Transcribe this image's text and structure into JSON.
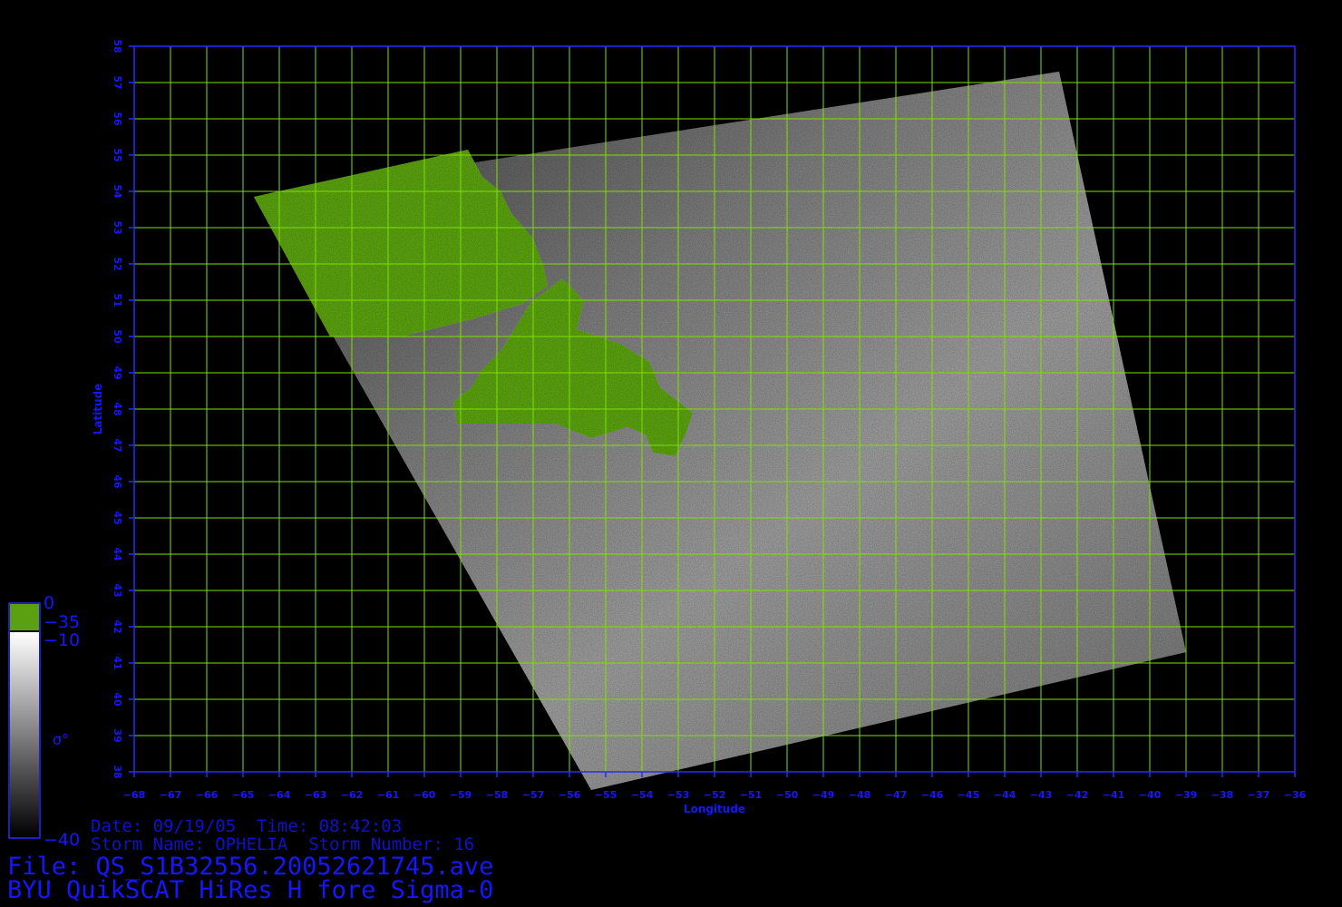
{
  "map": {
    "x_label": "Longitude",
    "y_label": "Latitude",
    "lon_range": [
      -68,
      -36
    ],
    "lat_range": [
      38,
      58
    ],
    "grid_color": "#7fe000",
    "frame_color": "#2b2bff",
    "land_color": "#5aa010",
    "swath_corners": [
      [
        -64.7,
        53.85
      ],
      [
        -42.5,
        57.3
      ],
      [
        -39.0,
        41.3
      ],
      [
        -55.4,
        37.5
      ]
    ],
    "land_mask": [
      [
        [
          -64.7,
          53.85
        ],
        [
          -58.8,
          55.15
        ],
        [
          -58.4,
          54.4
        ],
        [
          -57.9,
          54.0
        ],
        [
          -57.6,
          53.4
        ],
        [
          -57.0,
          52.7
        ],
        [
          -56.7,
          51.9
        ],
        [
          -56.6,
          51.4
        ],
        [
          -57.3,
          50.9
        ],
        [
          -58.6,
          50.5
        ],
        [
          -60.6,
          50.0
        ],
        [
          -62.6,
          50.0
        ]
      ]
    ],
    "island_mask": [
      [
        [
          -56.2,
          51.6
        ],
        [
          -55.6,
          51.0
        ],
        [
          -55.8,
          50.2
        ],
        [
          -54.6,
          49.8
        ],
        [
          -53.8,
          49.3
        ],
        [
          -53.5,
          48.6
        ],
        [
          -53.0,
          48.2
        ],
        [
          -52.6,
          47.9
        ],
        [
          -52.8,
          47.3
        ],
        [
          -53.1,
          46.7
        ],
        [
          -53.7,
          46.8
        ],
        [
          -53.9,
          47.3
        ],
        [
          -54.4,
          47.5
        ],
        [
          -55.4,
          47.2
        ],
        [
          -56.4,
          47.6
        ],
        [
          -57.5,
          47.6
        ],
        [
          -59.1,
          47.6
        ],
        [
          -59.2,
          48.2
        ],
        [
          -58.7,
          48.6
        ],
        [
          -58.4,
          49.1
        ],
        [
          -57.9,
          49.6
        ],
        [
          -57.4,
          50.4
        ],
        [
          -57.1,
          50.9
        ],
        [
          -56.6,
          51.3
        ]
      ]
    ]
  },
  "colorbar": {
    "label_top": "0",
    "label_land": "−35",
    "label_high": "−10",
    "label_sym": "σ°",
    "label_bottom": "−40",
    "land_color": "#5aa010"
  },
  "info": {
    "date_line": "Date: 09/19/05  Time: 08:42:03",
    "storm_line": "Storm Name: OPHELIA  Storm Number: 16",
    "file_line": "File: QS_S1B32556.20052621745.ave",
    "title_line": "BYU QuikSCAT HiRes H fore Sigma-0"
  }
}
